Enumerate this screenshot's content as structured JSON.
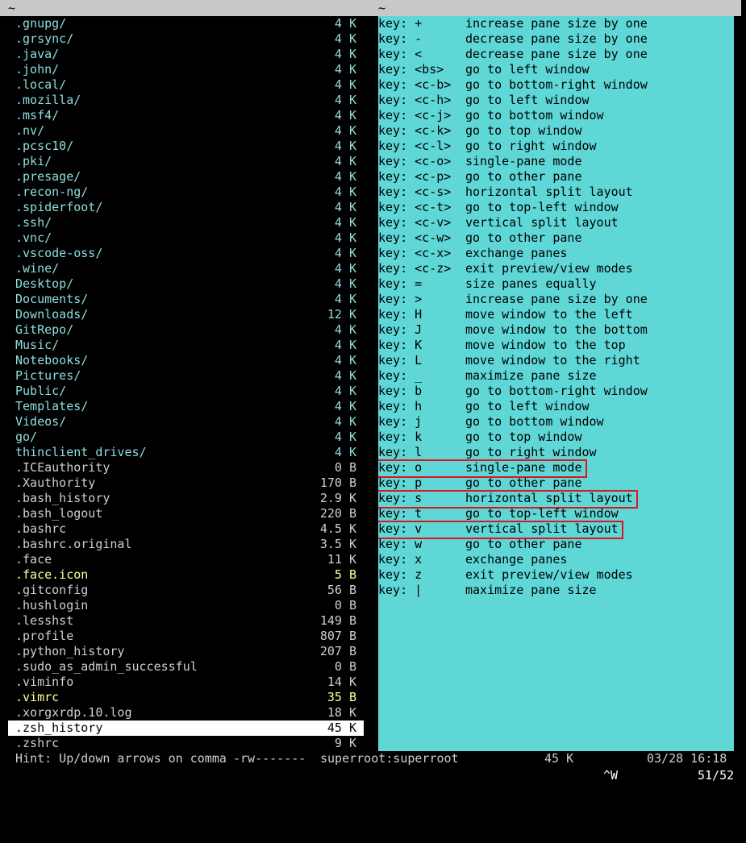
{
  "titlebar": {
    "left_title": "~",
    "right_title": "~"
  },
  "files": [
    {
      "name": ".gnupg/",
      "size": "4 K",
      "type": "dir"
    },
    {
      "name": ".grsync/",
      "size": "4 K",
      "type": "dir"
    },
    {
      "name": ".java/",
      "size": "4 K",
      "type": "dir"
    },
    {
      "name": ".john/",
      "size": "4 K",
      "type": "dir"
    },
    {
      "name": ".local/",
      "size": "4 K",
      "type": "dir"
    },
    {
      "name": ".mozilla/",
      "size": "4 K",
      "type": "dir"
    },
    {
      "name": ".msf4/",
      "size": "4 K",
      "type": "dir"
    },
    {
      "name": ".nv/",
      "size": "4 K",
      "type": "dir"
    },
    {
      "name": ".pcsc10/",
      "size": "4 K",
      "type": "dir"
    },
    {
      "name": ".pki/",
      "size": "4 K",
      "type": "dir"
    },
    {
      "name": ".presage/",
      "size": "4 K",
      "type": "dir"
    },
    {
      "name": ".recon-ng/",
      "size": "4 K",
      "type": "dir"
    },
    {
      "name": ".spiderfoot/",
      "size": "4 K",
      "type": "dir"
    },
    {
      "name": ".ssh/",
      "size": "4 K",
      "type": "dir"
    },
    {
      "name": ".vnc/",
      "size": "4 K",
      "type": "dir"
    },
    {
      "name": ".vscode-oss/",
      "size": "4 K",
      "type": "dir"
    },
    {
      "name": ".wine/",
      "size": "4 K",
      "type": "dir"
    },
    {
      "name": "Desktop/",
      "size": "4 K",
      "type": "dir"
    },
    {
      "name": "Documents/",
      "size": "4 K",
      "type": "dir"
    },
    {
      "name": "Downloads/",
      "size": "12 K",
      "type": "dir"
    },
    {
      "name": "GitRepo/",
      "size": "4 K",
      "type": "dir"
    },
    {
      "name": "Music/",
      "size": "4 K",
      "type": "dir"
    },
    {
      "name": "Notebooks/",
      "size": "4 K",
      "type": "dir"
    },
    {
      "name": "Pictures/",
      "size": "4 K",
      "type": "dir"
    },
    {
      "name": "Public/",
      "size": "4 K",
      "type": "dir"
    },
    {
      "name": "Templates/",
      "size": "4 K",
      "type": "dir"
    },
    {
      "name": "Videos/",
      "size": "4 K",
      "type": "dir"
    },
    {
      "name": "go/",
      "size": "4 K",
      "type": "dir"
    },
    {
      "name": "thinclient_drives/",
      "size": "4 K",
      "type": "dir"
    },
    {
      "name": ".ICEauthority",
      "size": "0 B",
      "type": "file"
    },
    {
      "name": ".Xauthority",
      "size": "170 B",
      "type": "file"
    },
    {
      "name": ".bash_history",
      "size": "2.9 K",
      "type": "file"
    },
    {
      "name": ".bash_logout",
      "size": "220 B",
      "type": "file"
    },
    {
      "name": ".bashrc",
      "size": "4.5 K",
      "type": "file"
    },
    {
      "name": ".bashrc.original",
      "size": "3.5 K",
      "type": "file"
    },
    {
      "name": ".face",
      "size": "11 K",
      "type": "file"
    },
    {
      "name": ".face.icon",
      "size": "5 B",
      "type": "exe"
    },
    {
      "name": ".gitconfig",
      "size": "56 B",
      "type": "file"
    },
    {
      "name": ".hushlogin",
      "size": "0 B",
      "type": "file"
    },
    {
      "name": ".lesshst",
      "size": "149 B",
      "type": "file"
    },
    {
      "name": ".profile",
      "size": "807 B",
      "type": "file"
    },
    {
      "name": ".python_history",
      "size": "207 B",
      "type": "file"
    },
    {
      "name": ".sudo_as_admin_successful",
      "size": "0 B",
      "type": "file"
    },
    {
      "name": ".viminfo",
      "size": "14 K",
      "type": "file"
    },
    {
      "name": ".vimrc",
      "size": "35 B",
      "type": "exe"
    },
    {
      "name": ".xorgxrdp.10.log",
      "size": "18 K",
      "type": "file"
    },
    {
      "name": ".zsh_history",
      "size": "45 K",
      "type": "selected"
    },
    {
      "name": ".zshrc",
      "size": "9 K",
      "type": "file"
    }
  ],
  "keybindings": [
    {
      "key": "key: +",
      "desc": "increase pane size by one"
    },
    {
      "key": "key: -",
      "desc": "decrease pane size by one"
    },
    {
      "key": "key: <",
      "desc": "decrease pane size by one"
    },
    {
      "key": "key: <bs>",
      "desc": "go to left window"
    },
    {
      "key": "key: <c-b>",
      "desc": "go to bottom-right window"
    },
    {
      "key": "key: <c-h>",
      "desc": "go to left window"
    },
    {
      "key": "key: <c-j>",
      "desc": "go to bottom window"
    },
    {
      "key": "key: <c-k>",
      "desc": "go to top window"
    },
    {
      "key": "key: <c-l>",
      "desc": "go to right window"
    },
    {
      "key": "key: <c-o>",
      "desc": "single-pane mode"
    },
    {
      "key": "key: <c-p>",
      "desc": "go to other pane"
    },
    {
      "key": "key: <c-s>",
      "desc": "horizontal split layout"
    },
    {
      "key": "key: <c-t>",
      "desc": "go to top-left window"
    },
    {
      "key": "key: <c-v>",
      "desc": "vertical split layout"
    },
    {
      "key": "key: <c-w>",
      "desc": "go to other pane"
    },
    {
      "key": "key: <c-x>",
      "desc": "exchange panes"
    },
    {
      "key": "key: <c-z>",
      "desc": "exit preview/view modes"
    },
    {
      "key": "key: =",
      "desc": "size panes equally"
    },
    {
      "key": "key: >",
      "desc": "increase pane size by one"
    },
    {
      "key": "key: H",
      "desc": "move window to the left"
    },
    {
      "key": "key: J",
      "desc": "move window to the bottom"
    },
    {
      "key": "key: K",
      "desc": "move window to the top"
    },
    {
      "key": "key: L",
      "desc": "move window to the right"
    },
    {
      "key": "key: _",
      "desc": "maximize pane size"
    },
    {
      "key": "key: b",
      "desc": "go to bottom-right window"
    },
    {
      "key": "key: h",
      "desc": "go to left window"
    },
    {
      "key": "key: j",
      "desc": "go to bottom window"
    },
    {
      "key": "key: k",
      "desc": "go to top window"
    },
    {
      "key": "key: l",
      "desc": "go to right window"
    },
    {
      "key": "key: o",
      "desc": "single-pane mode",
      "highlight": true
    },
    {
      "key": "key: p",
      "desc": "go to other pane"
    },
    {
      "key": "key: s",
      "desc": "horizontal split layout",
      "highlight": true
    },
    {
      "key": "key: t",
      "desc": "go to top-left window"
    },
    {
      "key": "key: v",
      "desc": "vertical split layout",
      "highlight": true
    },
    {
      "key": "key: w",
      "desc": "go to other pane"
    },
    {
      "key": "key: x",
      "desc": "exchange panes"
    },
    {
      "key": "key: z",
      "desc": "exit preview/view modes"
    },
    {
      "key": "key: |",
      "desc": "maximize pane size"
    }
  ],
  "statusbar": {
    "hint": "Hint: Up/down arrows on comma",
    "permissions": "-rw-------",
    "owner": "superroot:superroot",
    "size": "45 K",
    "datetime": "03/28 16:18"
  },
  "bottombar": {
    "keys": "^W",
    "position": "51/52"
  },
  "colors": {
    "dir": "#8fdede",
    "file": "#cfcfcf",
    "exe": "#ffffa0",
    "help_bg": "#5fd7d7",
    "highlight_box": "#e0141e"
  }
}
